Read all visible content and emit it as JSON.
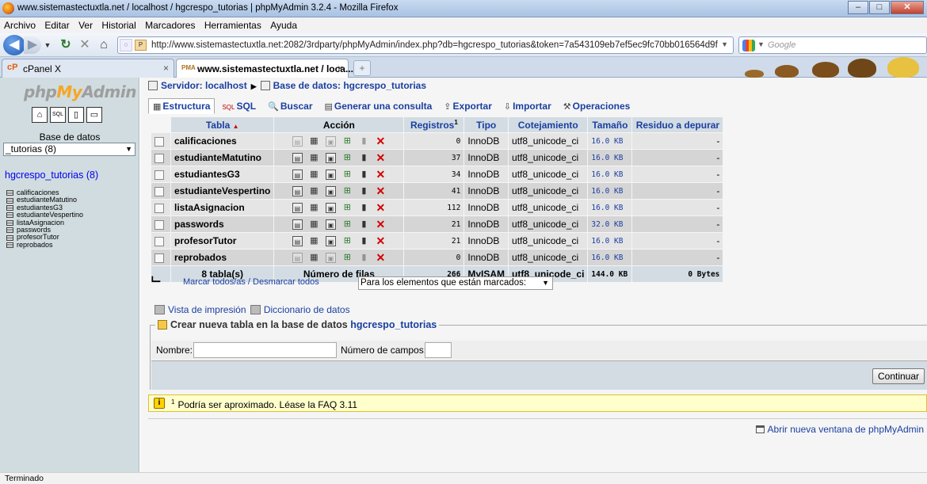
{
  "window": {
    "title": "www.sistemastectuxtla.net / localhost / hgcrespo_tutorias | phpMyAdmin 3.2.4 - Mozilla Firefox"
  },
  "menu": [
    "Archivo",
    "Editar",
    "Ver",
    "Historial",
    "Marcadores",
    "Herramientas",
    "Ayuda"
  ],
  "nav": {
    "url": "http://www.sistemastectuxtla.net:2082/3rdparty/phpMyAdmin/index.php?db=hgcrespo_tutorias&token=7a543109eb7ef5ec9fc70bb016564d9f",
    "search_placeholder": "Google"
  },
  "tabs": [
    {
      "icon": "cP",
      "label": "cPanel X"
    },
    {
      "icon": "PMA",
      "label": "www.sistemastectuxtla.net / loca..."
    }
  ],
  "left": {
    "logo_php": "php",
    "logo_my": "My",
    "logo_admin": "Admin",
    "db_label": "Base de datos",
    "db_select": "_tutorias (8)",
    "db_name": "hgcrespo_tutorias",
    "db_count": "(8)",
    "tables": [
      "calificaciones",
      "estudianteMatutino",
      "estudiantesG3",
      "estudianteVespertino",
      "listaAsignacion",
      "passwords",
      "profesorTutor",
      "reprobados"
    ]
  },
  "main": {
    "breadcrumb": {
      "server": "Servidor: localhost",
      "database": "Base de datos: hgcrespo_tutorias"
    },
    "tabs": [
      {
        "icon": "▦",
        "label": "Estructura",
        "active": true
      },
      {
        "icon": "SQL",
        "label": "SQL"
      },
      {
        "icon": "🔍",
        "label": "Buscar"
      },
      {
        "icon": "▤",
        "label": "Generar una consulta"
      },
      {
        "icon": "⇪",
        "label": "Exportar"
      },
      {
        "icon": "⇩",
        "label": "Importar"
      },
      {
        "icon": "⚒",
        "label": "Operaciones"
      }
    ],
    "columns": {
      "tabla": "Tabla",
      "accion": "Acción",
      "registros": "Registros",
      "registros_sup": "1",
      "tipo": "Tipo",
      "cotejamiento": "Cotejamiento",
      "tamano": "Tamaño",
      "residuo": "Residuo a depurar"
    },
    "rows": [
      {
        "name": "calificaciones",
        "records": "0",
        "type": "InnoDB",
        "collation": "utf8_unicode_ci",
        "size": "16.0 KB",
        "overhead": "-"
      },
      {
        "name": "estudianteMatutino",
        "records": "37",
        "type": "InnoDB",
        "collation": "utf8_unicode_ci",
        "size": "16.0 KB",
        "overhead": "-"
      },
      {
        "name": "estudiantesG3",
        "records": "34",
        "type": "InnoDB",
        "collation": "utf8_unicode_ci",
        "size": "16.0 KB",
        "overhead": "-"
      },
      {
        "name": "estudianteVespertino",
        "records": "41",
        "type": "InnoDB",
        "collation": "utf8_unicode_ci",
        "size": "16.0 KB",
        "overhead": "-"
      },
      {
        "name": "listaAsignacion",
        "records": "112",
        "type": "InnoDB",
        "collation": "utf8_unicode_ci",
        "size": "16.0 KB",
        "overhead": "-"
      },
      {
        "name": "passwords",
        "records": "21",
        "type": "InnoDB",
        "collation": "utf8_unicode_ci",
        "size": "32.0 KB",
        "overhead": "-"
      },
      {
        "name": "profesorTutor",
        "records": "21",
        "type": "InnoDB",
        "collation": "utf8_unicode_ci",
        "size": "16.0 KB",
        "overhead": "-"
      },
      {
        "name": "reprobados",
        "records": "0",
        "type": "InnoDB",
        "collation": "utf8_unicode_ci",
        "size": "16.0 KB",
        "overhead": "-"
      }
    ],
    "footer": {
      "count": "8 tabla(s)",
      "label": "Número de filas",
      "records": "266",
      "type": "MyISAM",
      "collation": "utf8_unicode_ci",
      "size": "144.0 KB",
      "overhead": "0 Bytes"
    },
    "mark_all": "Marcar todos/as / Desmarcar todos",
    "with_selected": "Para los elementos que están marcados:",
    "print_view": "Vista de impresión",
    "data_dictionary": "Diccionario de datos",
    "create": {
      "legend": "Crear nueva tabla en la base de datos",
      "db": "hgcrespo_tutorias",
      "name_label": "Nombre:",
      "fields_label": "Número de campos:",
      "name_value": "",
      "fields_value": "",
      "continue": "Continuar"
    },
    "notice": {
      "sup": "1",
      "text": "Podría ser aproximado. Léase la FAQ 3.11"
    },
    "new_window": "Abrir nueva ventana de phpMyAdmin"
  },
  "status": "Terminado"
}
